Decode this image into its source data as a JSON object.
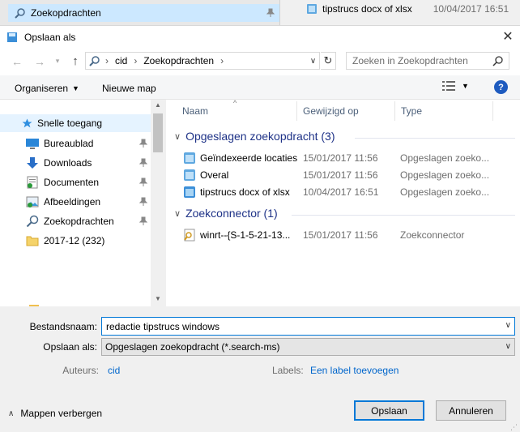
{
  "background_window": {
    "left_item": "Zoekopdrachten",
    "right_item_name": "tipstrucs docx of xlsx",
    "right_item_date": "10/04/2017 16:51"
  },
  "dialog": {
    "title": "Opslaan als",
    "close_symbol": "✕"
  },
  "nav": {
    "path": [
      "cid",
      "Zoekopdrachten"
    ],
    "search_placeholder": "Zoeken in Zoekopdrachten"
  },
  "toolbar": {
    "organize": "Organiseren",
    "new_folder": "Nieuwe map",
    "help": "?"
  },
  "sidebar": {
    "items": [
      {
        "label": "Snelle toegang",
        "icon": "star-icon"
      },
      {
        "label": "Bureaublad",
        "icon": "desktop-icon"
      },
      {
        "label": "Downloads",
        "icon": "download-icon"
      },
      {
        "label": "Documenten",
        "icon": "documents-icon"
      },
      {
        "label": "Afbeeldingen",
        "icon": "pictures-icon"
      },
      {
        "label": "Zoekopdrachten",
        "icon": "search-folder-icon"
      },
      {
        "label": "2017-12 (232)",
        "icon": "folder-icon"
      }
    ]
  },
  "columns": {
    "name": "Naam",
    "modified": "Gewijzigd op",
    "type": "Type"
  },
  "groups": [
    {
      "title": "Opgeslagen zoekopdracht (3)",
      "rows": [
        {
          "name": "Geïndexeerde locaties",
          "date": "15/01/2017 11:56",
          "type": "Opgeslagen zoeko..."
        },
        {
          "name": "Overal",
          "date": "15/01/2017 11:56",
          "type": "Opgeslagen zoeko..."
        },
        {
          "name": "tipstrucs docx of xlsx",
          "date": "10/04/2017 16:51",
          "type": "Opgeslagen zoeko..."
        }
      ]
    },
    {
      "title": "Zoekconnector (1)",
      "rows": [
        {
          "name": "winrt--{S-1-5-21-13...",
          "date": "15/01/2017 11:56",
          "type": "Zoekconnector"
        }
      ]
    }
  ],
  "form": {
    "filename_label": "Bestandsnaam:",
    "filename_value": "redactie tipstrucs windows",
    "savetype_label": "Opslaan als:",
    "savetype_value": "Opgeslagen zoekopdracht (*.search-ms)",
    "authors_label": "Auteurs:",
    "authors_value": "cid",
    "labels_label": "Labels:",
    "labels_value": "Een label toevoegen"
  },
  "footer": {
    "hide_folders": "Mappen verbergen",
    "save": "Opslaan",
    "cancel": "Annuleren"
  }
}
